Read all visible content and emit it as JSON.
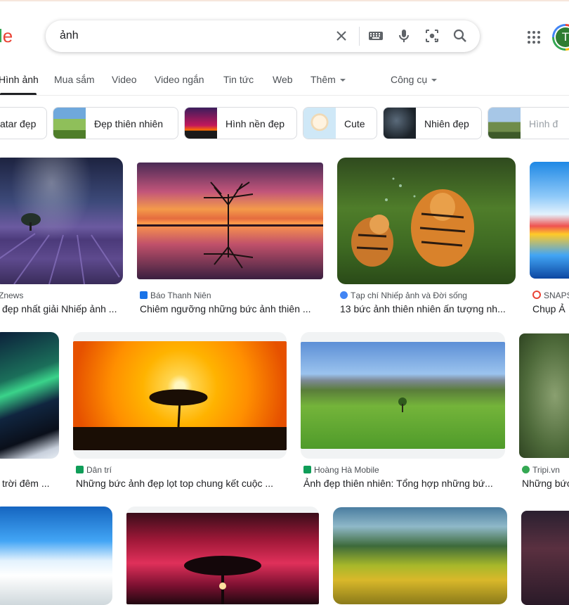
{
  "logo": {
    "part1": "l",
    "part2": "e"
  },
  "search": {
    "query": "ảnh"
  },
  "icons": {
    "clear": "close-icon",
    "keyboard": "keyboard-icon",
    "mic": "microphone-icon",
    "lens": "camera-lens-icon",
    "search": "search-icon",
    "apps": "apps-grid-icon"
  },
  "account": {
    "initial": "T"
  },
  "tabs": [
    {
      "label": "Hình ảnh",
      "active": true
    },
    {
      "label": "Mua sắm"
    },
    {
      "label": "Video"
    },
    {
      "label": "Video ngắn"
    },
    {
      "label": "Tin tức"
    },
    {
      "label": "Web"
    },
    {
      "label": "Thêm"
    },
    {
      "label": "Công cụ"
    }
  ],
  "chips": [
    {
      "label": "atar đẹp"
    },
    {
      "label": "Đẹp thiên nhiên"
    },
    {
      "label": "Hình nền đẹp"
    },
    {
      "label": "Cute"
    },
    {
      "label": "Nhiên đẹp"
    },
    {
      "label": "Hình đ"
    }
  ],
  "results": [
    {
      "source": "Znews",
      "title": "đẹp nhất giải Nhiếp ảnh ..."
    },
    {
      "source": "Báo Thanh Niên",
      "title": "Chiêm ngưỡng những bức ảnh thiên ..."
    },
    {
      "source": "Tạp chí Nhiếp ảnh và Đời sống",
      "title": "13 bức ảnh thiên nhiên ấn tượng nh..."
    },
    {
      "source": "SNAPS",
      "title": "Chụp Ả"
    },
    {
      "source": "",
      "title": "trời đêm ..."
    },
    {
      "source": "Dân trí",
      "title": "Những bức ảnh đẹp lọt top chung kết cuộc ..."
    },
    {
      "source": "Hoàng Hà Mobile",
      "title": "Ảnh đẹp thiên nhiên: Tổng hợp những bứ..."
    },
    {
      "source": "Tripi.vn",
      "title": "Những bức"
    }
  ],
  "colors": {
    "accent": "#1a73e8",
    "text": "#202124",
    "secondary": "#4d5156"
  }
}
